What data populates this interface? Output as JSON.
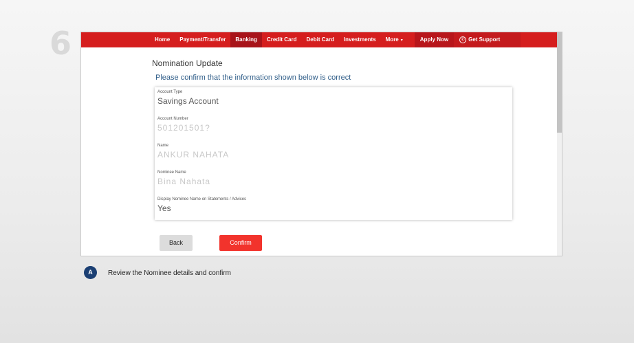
{
  "step": {
    "number": "6"
  },
  "nav": {
    "items": [
      {
        "label": "Home"
      },
      {
        "label": "Payment/Transfer"
      },
      {
        "label": "Banking"
      },
      {
        "label": "Credit Card"
      },
      {
        "label": "Debit Card"
      },
      {
        "label": "Investments"
      },
      {
        "label": "More"
      }
    ],
    "more_caret": "▾",
    "apply_label": "Apply Now",
    "support_label": "Get Support"
  },
  "page": {
    "title": "Nomination Update",
    "prompt": "Please confirm that the information shown below is correct"
  },
  "fields": [
    {
      "label": "Account Type",
      "value": "Savings Account"
    },
    {
      "label": "Account Number",
      "value": "501201501?"
    },
    {
      "label": "Name",
      "value": "ANKUR NAHATA"
    },
    {
      "label": "Nominee Name",
      "value": "Bina Nahata"
    },
    {
      "label": "Display Nominee Name on Statements / Advices",
      "value": "Yes"
    }
  ],
  "buttons": {
    "back": "Back",
    "confirm": "Confirm"
  },
  "annotation": {
    "badge": "A",
    "text": "Review the Nominee details and confirm"
  },
  "colors": {
    "brand_red": "#d51e1e",
    "confirm_red": "#f2332c",
    "badge_navy": "#1b3f73"
  }
}
